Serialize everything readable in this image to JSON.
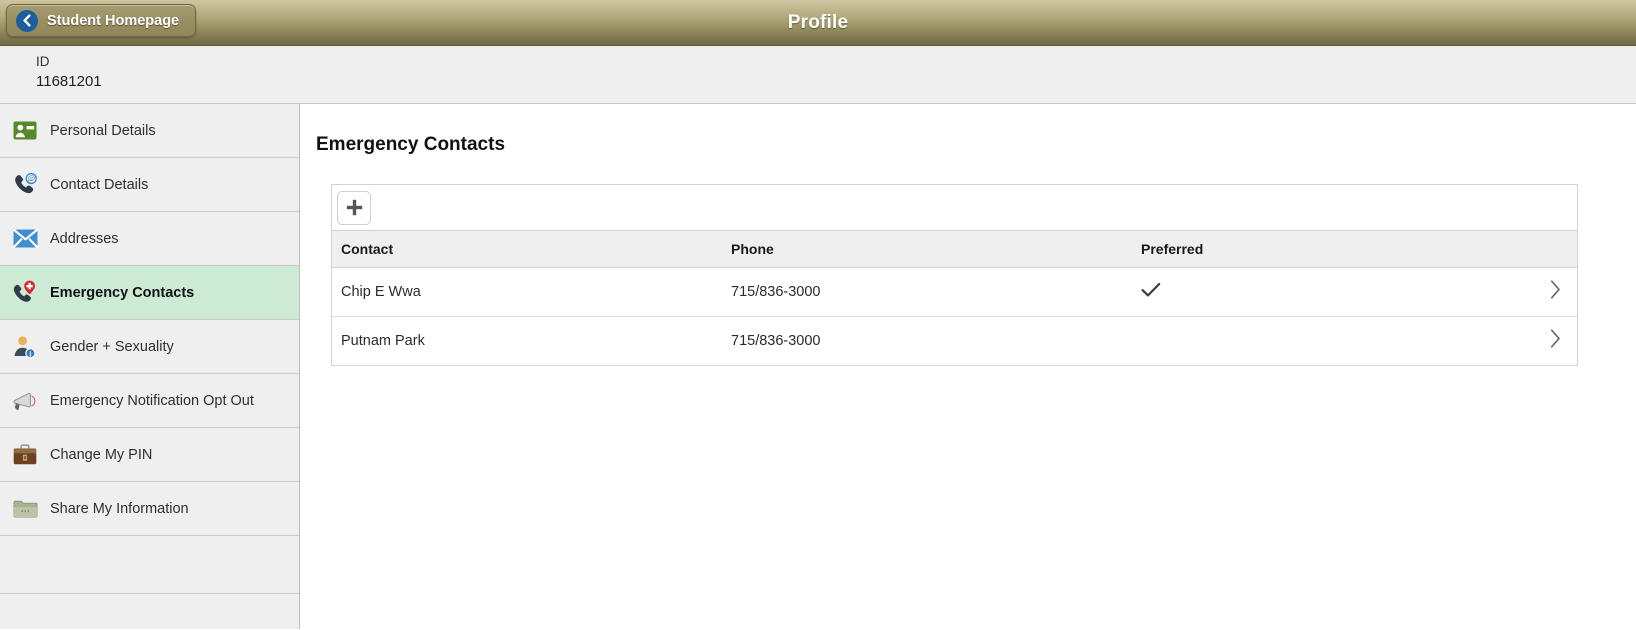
{
  "header": {
    "back_label": "Student Homepage",
    "back_icon": "chevron-left-circle-icon",
    "title": "Profile"
  },
  "id_band": {
    "label": "ID",
    "value": "11681201"
  },
  "sidebar": {
    "items": [
      {
        "label": "Personal Details",
        "icon": "id-card-icon",
        "selected": false
      },
      {
        "label": "Contact Details",
        "icon": "phone-at-icon",
        "selected": false
      },
      {
        "label": "Addresses",
        "icon": "envelope-icon",
        "selected": false
      },
      {
        "label": "Emergency Contacts",
        "icon": "phone-medical-pin-icon",
        "selected": true
      },
      {
        "label": "Gender + Sexuality",
        "icon": "person-info-icon",
        "selected": false
      },
      {
        "label": "Emergency Notification Opt Out",
        "icon": "megaphone-icon",
        "selected": false
      },
      {
        "label": "Change My PIN",
        "icon": "briefcase-icon",
        "selected": false
      },
      {
        "label": "Share My Information",
        "icon": "folder-icon",
        "selected": false
      }
    ]
  },
  "main": {
    "section_title": "Emergency Contacts",
    "add_button_label": "+",
    "add_button_icon": "plus-icon",
    "columns": [
      "Contact",
      "Phone",
      "Preferred"
    ],
    "rows": [
      {
        "contact": "Chip E Wwa",
        "phone": "715/836-3000",
        "preferred": true,
        "chevron": "chevron-right-icon"
      },
      {
        "contact": "Putnam Park",
        "phone": "715/836-3000",
        "preferred": false,
        "chevron": "chevron-right-icon"
      }
    ]
  },
  "colors": {
    "header_gradient_top": "#cfc69f",
    "header_gradient_bottom": "#6d6a45",
    "selected_nav": "#cdead5",
    "band_background": "#efefef",
    "back_circle": "#1b5e9e"
  }
}
